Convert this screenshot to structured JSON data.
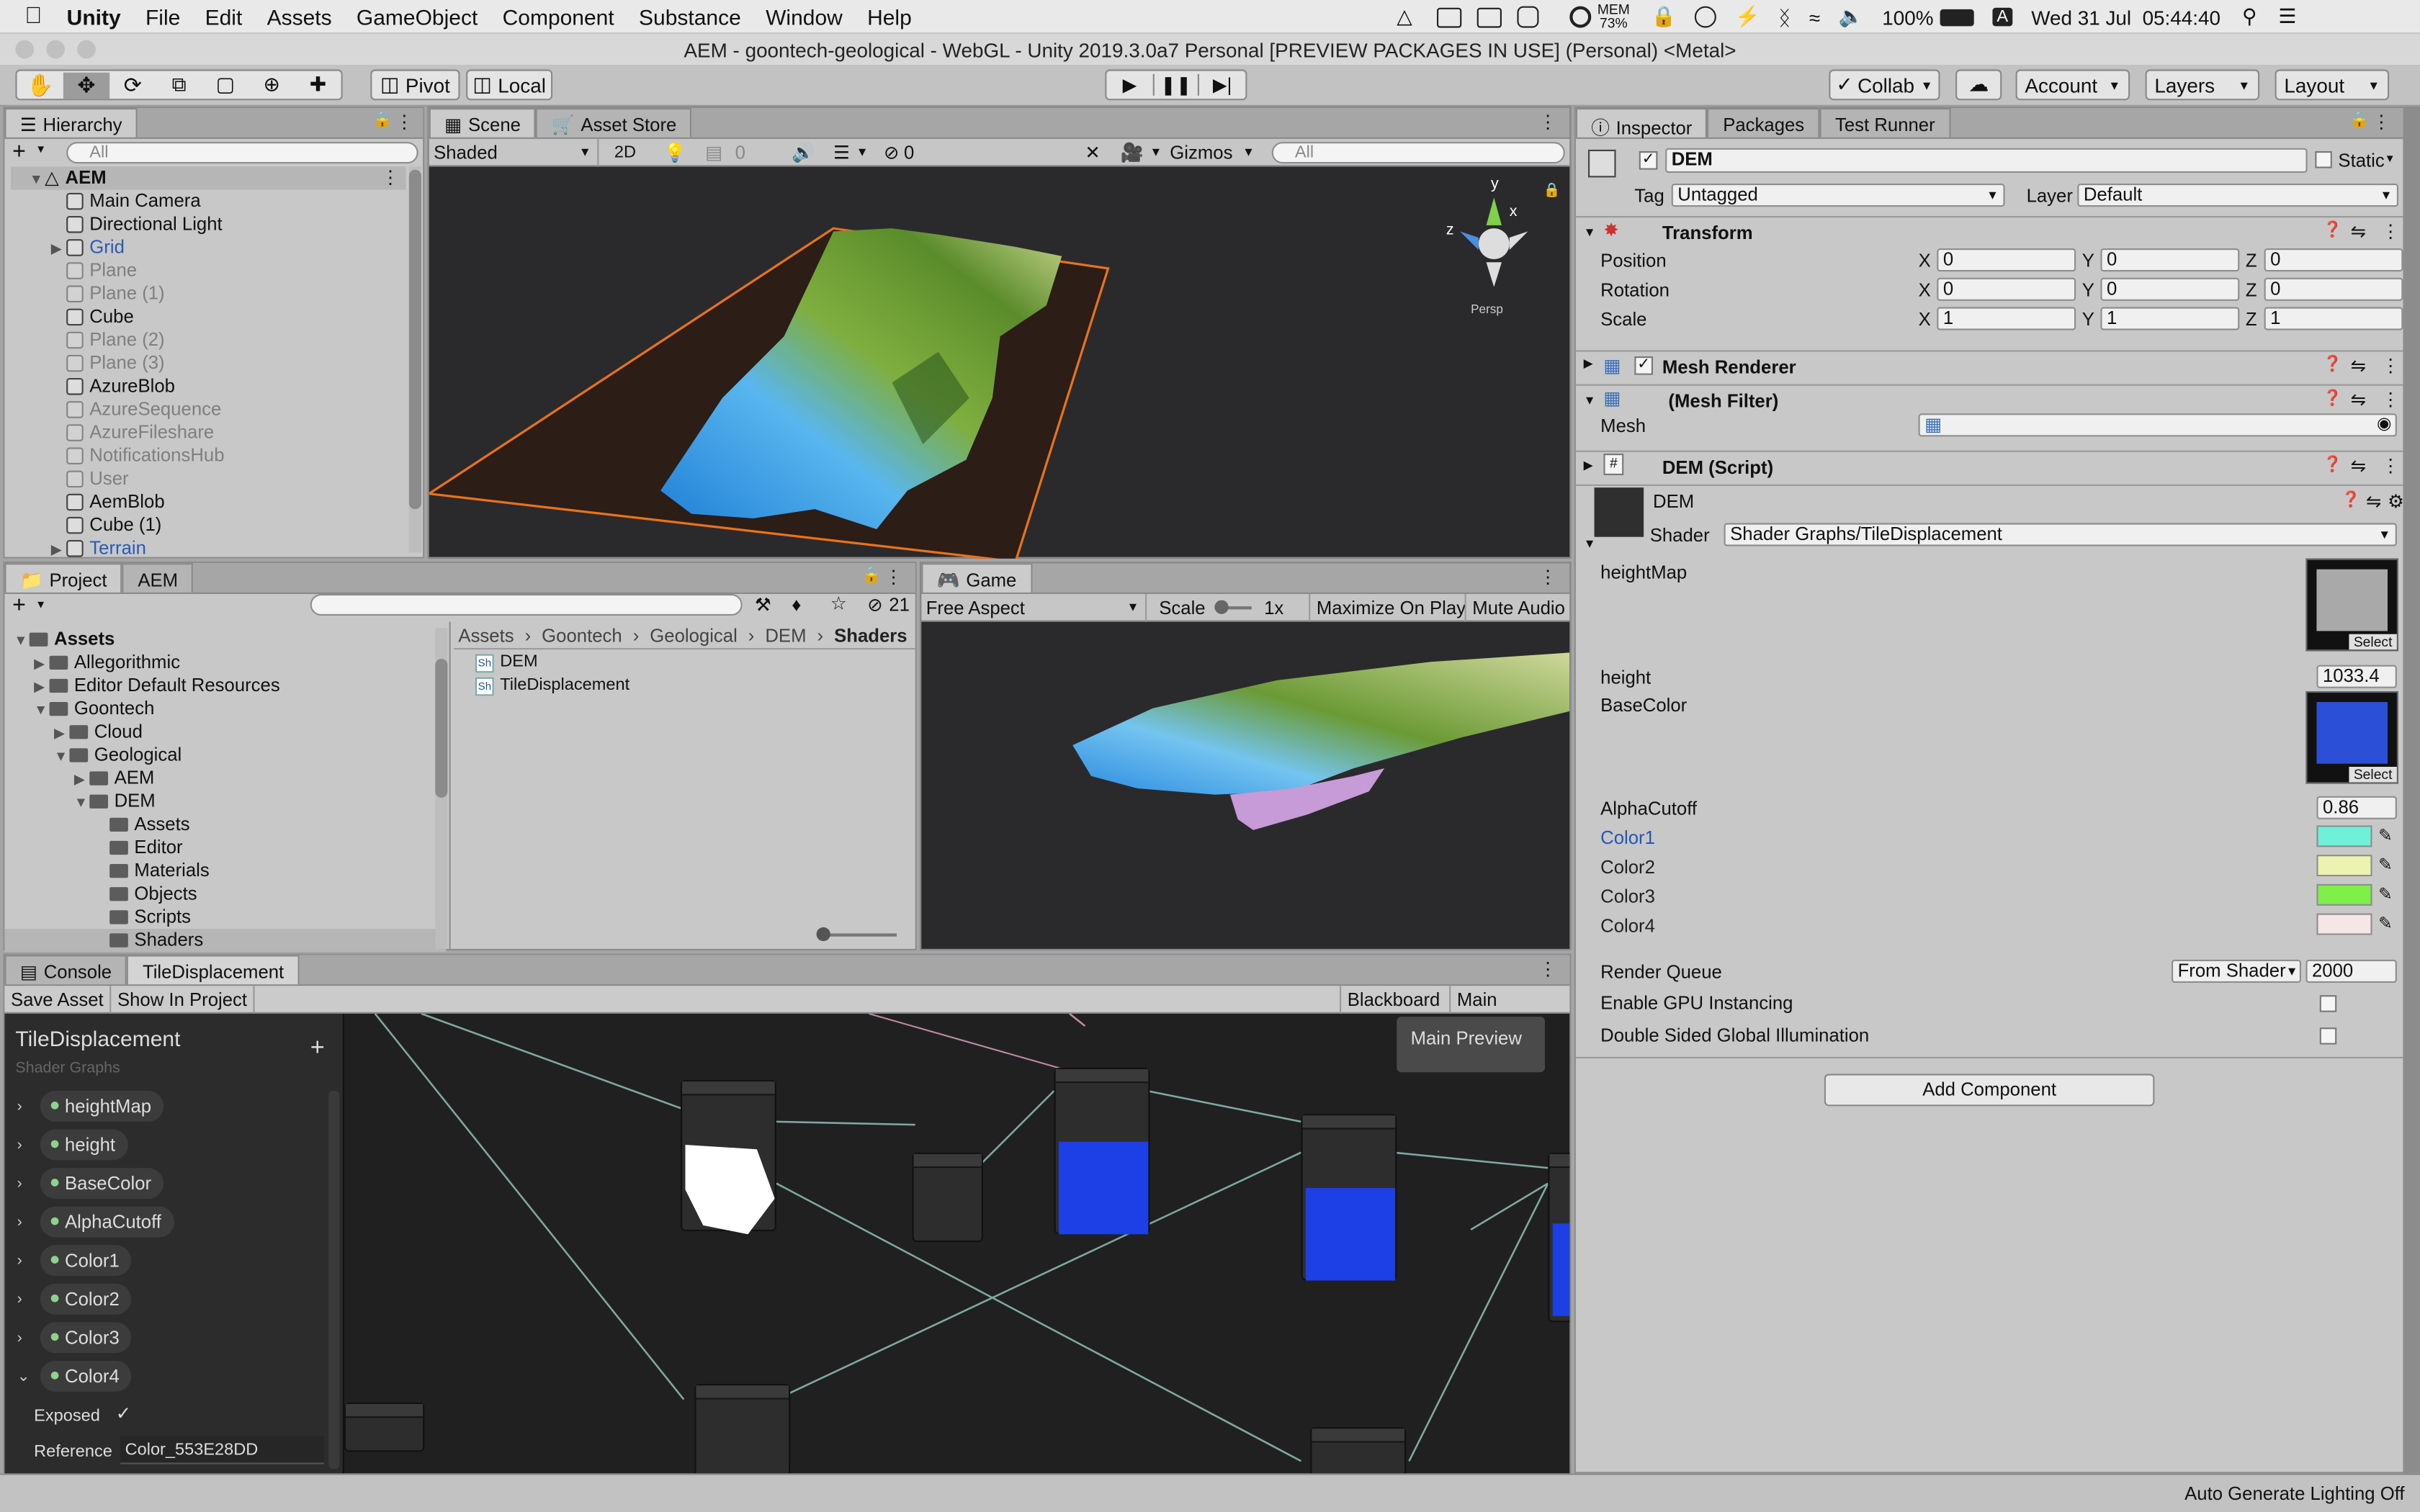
{
  "menubar": {
    "app": "Unity",
    "items": [
      "File",
      "Edit",
      "Assets",
      "GameObject",
      "Component",
      "Substance",
      "Window",
      "Help"
    ],
    "mem_label": "MEM",
    "mem_value": "73%",
    "battery": "100%",
    "input_source": "A",
    "clock": "Wed 31 Jul  05:44:40"
  },
  "window": {
    "title": "AEM - goontech-geological - WebGL - Unity 2019.3.0a7 Personal [PREVIEW PACKAGES IN USE] (Personal) <Metal>"
  },
  "toolbar": {
    "pivot": "Pivot",
    "local": "Local",
    "collab": "Collab",
    "account": "Account",
    "layers": "Layers",
    "layout": "Layout"
  },
  "hierarchy": {
    "tab": "Hierarchy",
    "search_placeholder": "All",
    "root": "AEM",
    "items": [
      {
        "label": "Main Camera",
        "state": "active"
      },
      {
        "label": "Directional Light",
        "state": "active"
      },
      {
        "label": "Grid",
        "state": "prefab"
      },
      {
        "label": "Plane",
        "state": "inactive"
      },
      {
        "label": "Plane (1)",
        "state": "inactive"
      },
      {
        "label": "Cube",
        "state": "active"
      },
      {
        "label": "Plane (2)",
        "state": "inactive"
      },
      {
        "label": "Plane (3)",
        "state": "inactive"
      },
      {
        "label": "AzureBlob",
        "state": "active"
      },
      {
        "label": "AzureSequence",
        "state": "inactive"
      },
      {
        "label": "AzureFileshare",
        "state": "inactive"
      },
      {
        "label": "NotificationsHub",
        "state": "inactive"
      },
      {
        "label": "User",
        "state": "inactive"
      },
      {
        "label": "AemBlob",
        "state": "active"
      },
      {
        "label": "Cube (1)",
        "state": "active"
      },
      {
        "label": "Terrain",
        "state": "prefab"
      }
    ]
  },
  "scene": {
    "tabs": [
      "Scene",
      "Asset Store"
    ],
    "shading": "Shaded",
    "mode_2d": "2D",
    "fx_count": "0",
    "hidden_count": "0",
    "gizmos": "Gizmos",
    "search_placeholder": "All",
    "persp": "Persp",
    "axis_x": "x",
    "axis_y": "y",
    "axis_z": "z"
  },
  "project": {
    "tabs": [
      "Project",
      "AEM"
    ],
    "hidden_count": "21",
    "tree": [
      {
        "label": "Assets",
        "depth": 0,
        "bold": true,
        "expand": "open"
      },
      {
        "label": "Allegorithmic",
        "depth": 1,
        "expand": "closed"
      },
      {
        "label": "Editor Default Resources",
        "depth": 1,
        "expand": "closed"
      },
      {
        "label": "Goontech",
        "depth": 1,
        "expand": "open"
      },
      {
        "label": "Cloud",
        "depth": 2,
        "expand": "closed"
      },
      {
        "label": "Geological",
        "depth": 2,
        "expand": "open"
      },
      {
        "label": "AEM",
        "depth": 3,
        "expand": "closed"
      },
      {
        "label": "DEM",
        "depth": 3,
        "expand": "open"
      },
      {
        "label": "Assets",
        "depth": 4,
        "expand": "none"
      },
      {
        "label": "Editor",
        "depth": 4,
        "expand": "none"
      },
      {
        "label": "Materials",
        "depth": 4,
        "expand": "none"
      },
      {
        "label": "Objects",
        "depth": 4,
        "expand": "none"
      },
      {
        "label": "Scripts",
        "depth": 4,
        "expand": "none"
      },
      {
        "label": "Shaders",
        "depth": 4,
        "expand": "none"
      }
    ],
    "breadcrumb": [
      "Assets",
      "Goontech",
      "Geological",
      "DEM",
      "Shaders"
    ],
    "files": [
      "DEM",
      "TileDisplacement"
    ],
    "file_icon": "Sh"
  },
  "game": {
    "tab": "Game",
    "aspect": "Free Aspect",
    "scale_label": "Scale",
    "scale_value": "1x",
    "maximize": "Maximize On Play",
    "mute": "Mute Audio"
  },
  "shadergraph": {
    "tabs": [
      "Console",
      "TileDisplacement"
    ],
    "save": "Save Asset",
    "show": "Show In Project",
    "blackboard_btn": "Blackboard",
    "preview_btn": "Main Preview",
    "title": "TileDisplacement",
    "subtitle": "Shader Graphs",
    "properties": [
      "heightMap",
      "height",
      "BaseColor",
      "AlphaCutoff",
      "Color1",
      "Color2",
      "Color3",
      "Color4"
    ],
    "exposed_label": "Exposed",
    "reference_label": "Reference",
    "reference_value": "Color_553E28DD",
    "main_preview": "Main Preview"
  },
  "inspector": {
    "tabs": [
      "Inspector",
      "Packages",
      "Test Runner"
    ],
    "object_name": "DEM",
    "static": "Static",
    "tag_label": "Tag",
    "tag": "Untagged",
    "layer_label": "Layer",
    "layer": "Default",
    "transform": "Transform",
    "rows": [
      {
        "label": "Position",
        "x": "0",
        "y": "0",
        "z": "0"
      },
      {
        "label": "Rotation",
        "x": "0",
        "y": "0",
        "z": "0"
      },
      {
        "label": "Scale",
        "x": "1",
        "y": "1",
        "z": "1"
      }
    ],
    "mesh_renderer": "Mesh Renderer",
    "mesh_filter": "(Mesh Filter)",
    "mesh_label": "Mesh",
    "script": "DEM (Script)",
    "material": "DEM",
    "shader_label": "Shader",
    "shader": "Shader Graphs/TileDisplacement",
    "heightmap": "heightMap",
    "select": "Select",
    "height_label": "height",
    "height": "1033.4",
    "basecolor": "BaseColor",
    "alphacutoff_label": "AlphaCutoff",
    "alphacutoff": "0.86",
    "colors": [
      {
        "label": "Color1",
        "hex": "#6ff0d8",
        "highlight": true
      },
      {
        "label": "Color2",
        "hex": "#ecf3b0",
        "highlight": false
      },
      {
        "label": "Color3",
        "hex": "#7fef4a",
        "highlight": false
      },
      {
        "label": "Color4",
        "hex": "#f6e6e6",
        "highlight": false
      }
    ],
    "render_queue_label": "Render Queue",
    "render_queue_mode": "From Shader",
    "render_queue": "2000",
    "gpu_instancing": "Enable GPU Instancing",
    "double_sided": "Double Sided Global Illumination",
    "add_component": "Add Component"
  },
  "status": {
    "text": "Auto Generate Lighting Off"
  }
}
